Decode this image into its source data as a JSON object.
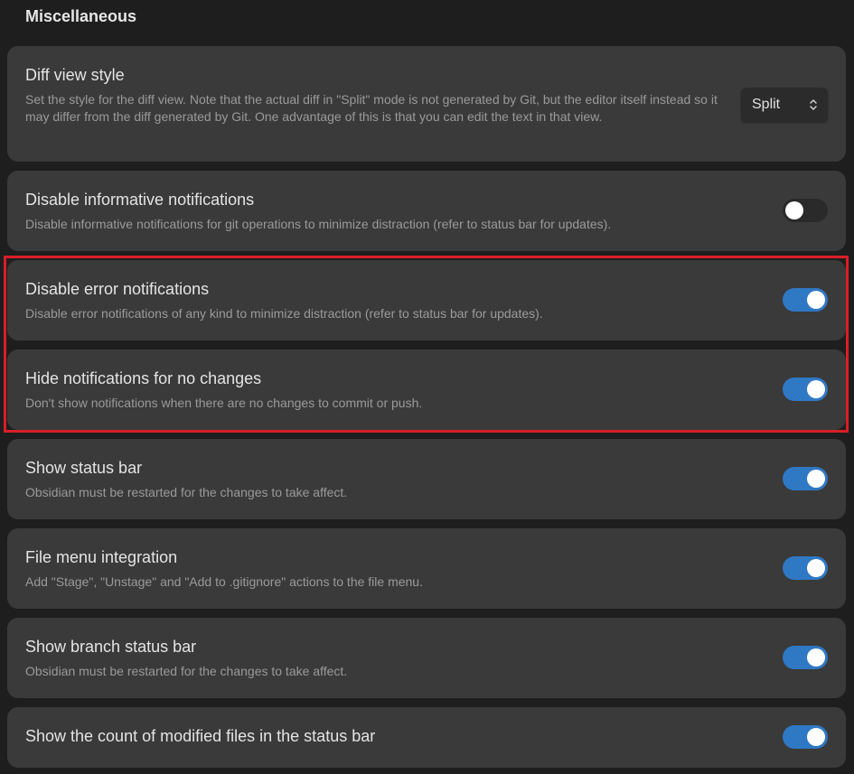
{
  "section": {
    "title": "Miscellaneous"
  },
  "settings": [
    {
      "name": "Diff view style",
      "description": "Set the style for the diff view. Note that the actual diff in \"Split\" mode is not generated by Git, but the editor itself instead so it may differ from the diff generated by Git. One advantage of this is that you can edit the text in that view.",
      "control": "dropdown",
      "value": "Split"
    },
    {
      "name": "Disable informative notifications",
      "description": "Disable informative notifications for git operations to minimize distraction (refer to status bar for updates).",
      "control": "toggle",
      "enabled": false
    },
    {
      "name": "Disable error notifications",
      "description": "Disable error notifications of any kind to minimize distraction (refer to status bar for updates).",
      "control": "toggle",
      "enabled": true
    },
    {
      "name": "Hide notifications for no changes",
      "description": "Don't show notifications when there are no changes to commit or push.",
      "control": "toggle",
      "enabled": true
    },
    {
      "name": "Show status bar",
      "description": "Obsidian must be restarted for the changes to take affect.",
      "control": "toggle",
      "enabled": true
    },
    {
      "name": "File menu integration",
      "description": "Add \"Stage\", \"Unstage\" and \"Add to .gitignore\" actions to the file menu.",
      "control": "toggle",
      "enabled": true
    },
    {
      "name": "Show branch status bar",
      "description": "Obsidian must be restarted for the changes to take affect.",
      "control": "toggle",
      "enabled": true
    },
    {
      "name": "Show the count of modified files in the status bar",
      "control": "toggle",
      "enabled": true
    }
  ],
  "colors": {
    "toggle_on": "#2f78c4",
    "highlight_border": "#d91e26"
  }
}
